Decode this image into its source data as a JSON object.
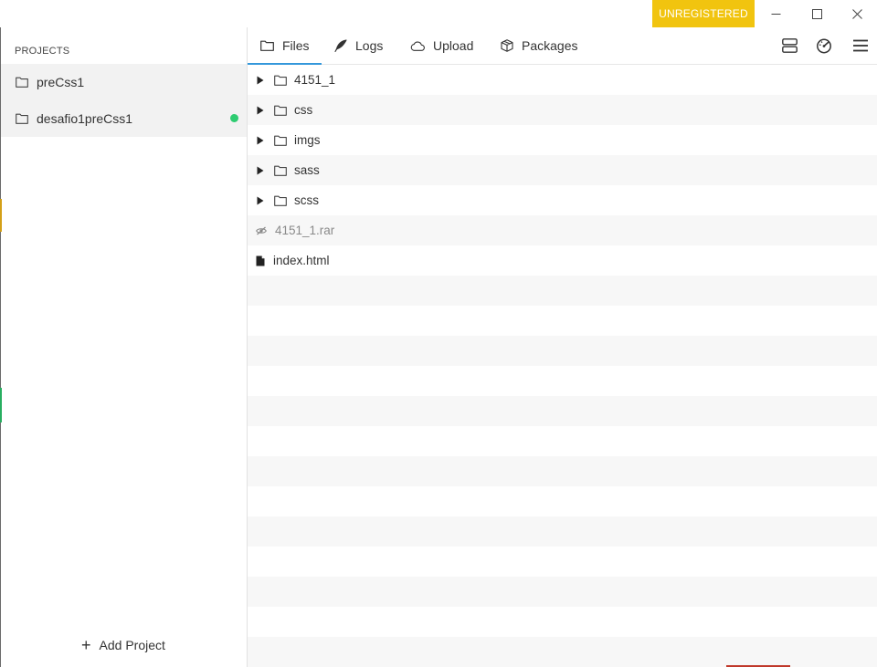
{
  "titlebar": {
    "badge": "UNREGISTERED",
    "controls": [
      "minimize-icon",
      "maximize-icon",
      "close-icon"
    ],
    "badge_color": "#f1c40f"
  },
  "sidebar": {
    "heading": "PROJECTS",
    "projects": [
      {
        "name": "preCss1",
        "icon": "folder-icon",
        "status": ""
      },
      {
        "name": "desafio1preCss1",
        "icon": "folder-icon",
        "status": "active",
        "status_color": "#2ecc71"
      }
    ],
    "add_project": {
      "icon": "plus-icon",
      "label": "Add Project"
    }
  },
  "tabs": [
    {
      "label": "Files",
      "icon": "folder-icon",
      "active": true
    },
    {
      "label": "Logs",
      "icon": "feather-icon",
      "active": false
    },
    {
      "label": "Upload",
      "icon": "cloud-icon",
      "active": false
    },
    {
      "label": "Packages",
      "icon": "box-icon",
      "active": false
    }
  ],
  "toolbar": {
    "icons": [
      "layout-icon",
      "speedometer-icon",
      "menu-icon"
    ],
    "accent": "#3498db"
  },
  "files": [
    {
      "name": "4151_1",
      "type": "folder"
    },
    {
      "name": "css",
      "type": "folder"
    },
    {
      "name": "imgs",
      "type": "folder"
    },
    {
      "name": "sass",
      "type": "folder"
    },
    {
      "name": "scss",
      "type": "folder"
    },
    {
      "name": "4151_1.rar",
      "type": "ignored-file"
    },
    {
      "name": "index.html",
      "type": "file"
    }
  ]
}
